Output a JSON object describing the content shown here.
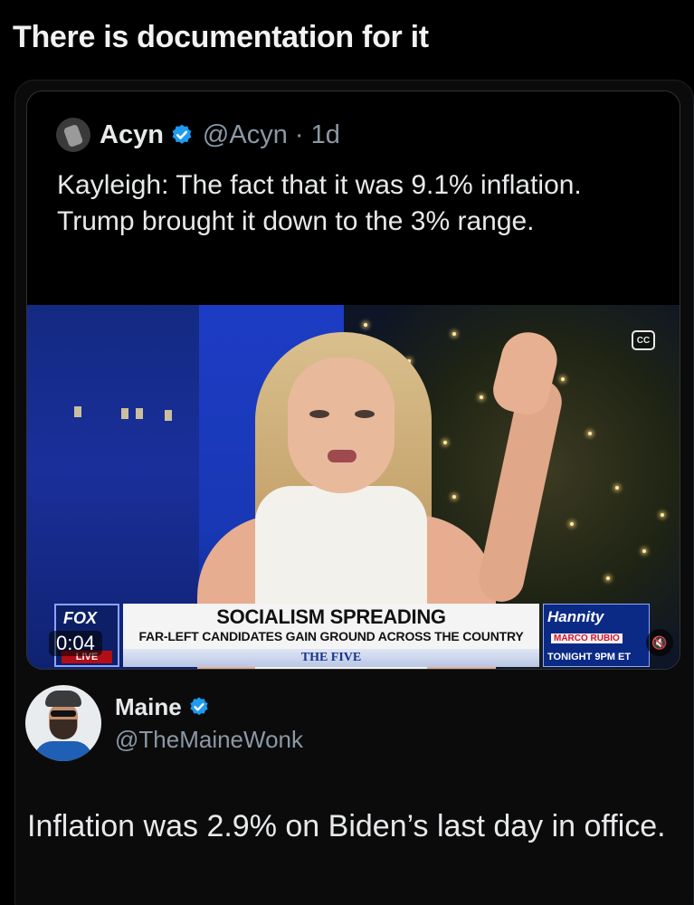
{
  "header": {
    "title": "There is documentation for it"
  },
  "quoted_post": {
    "author_name": "Acyn",
    "handle_time": "@Acyn · 1d",
    "text": "Kayleigh: The fact that it was 9.1% inflation. Trump brought it down to the 3% range.",
    "video": {
      "cc_label": "CC",
      "timestamp": "0:04",
      "network_logo": "FOX",
      "live_badge": "LIVE",
      "headline": "SOCIALISM SPREADING",
      "subheadline": "FAR-LEFT CANDIDATES GAIN GROUND ACROSS THE COUNTRY",
      "show_name": "THE FIVE",
      "promo_show": "Hannity",
      "promo_guest": "MARCO RUBIO",
      "promo_time": "TONIGHT 9PM ET"
    }
  },
  "reply_post": {
    "author_name": "Maine",
    "handle": "@TheMaineWonk",
    "text": "Inflation was 2.9% on Biden’s last day in office."
  },
  "colors": {
    "verified_blue": "#1d9bf0",
    "handle_gray": "#8b98a5",
    "background": "#000000"
  }
}
